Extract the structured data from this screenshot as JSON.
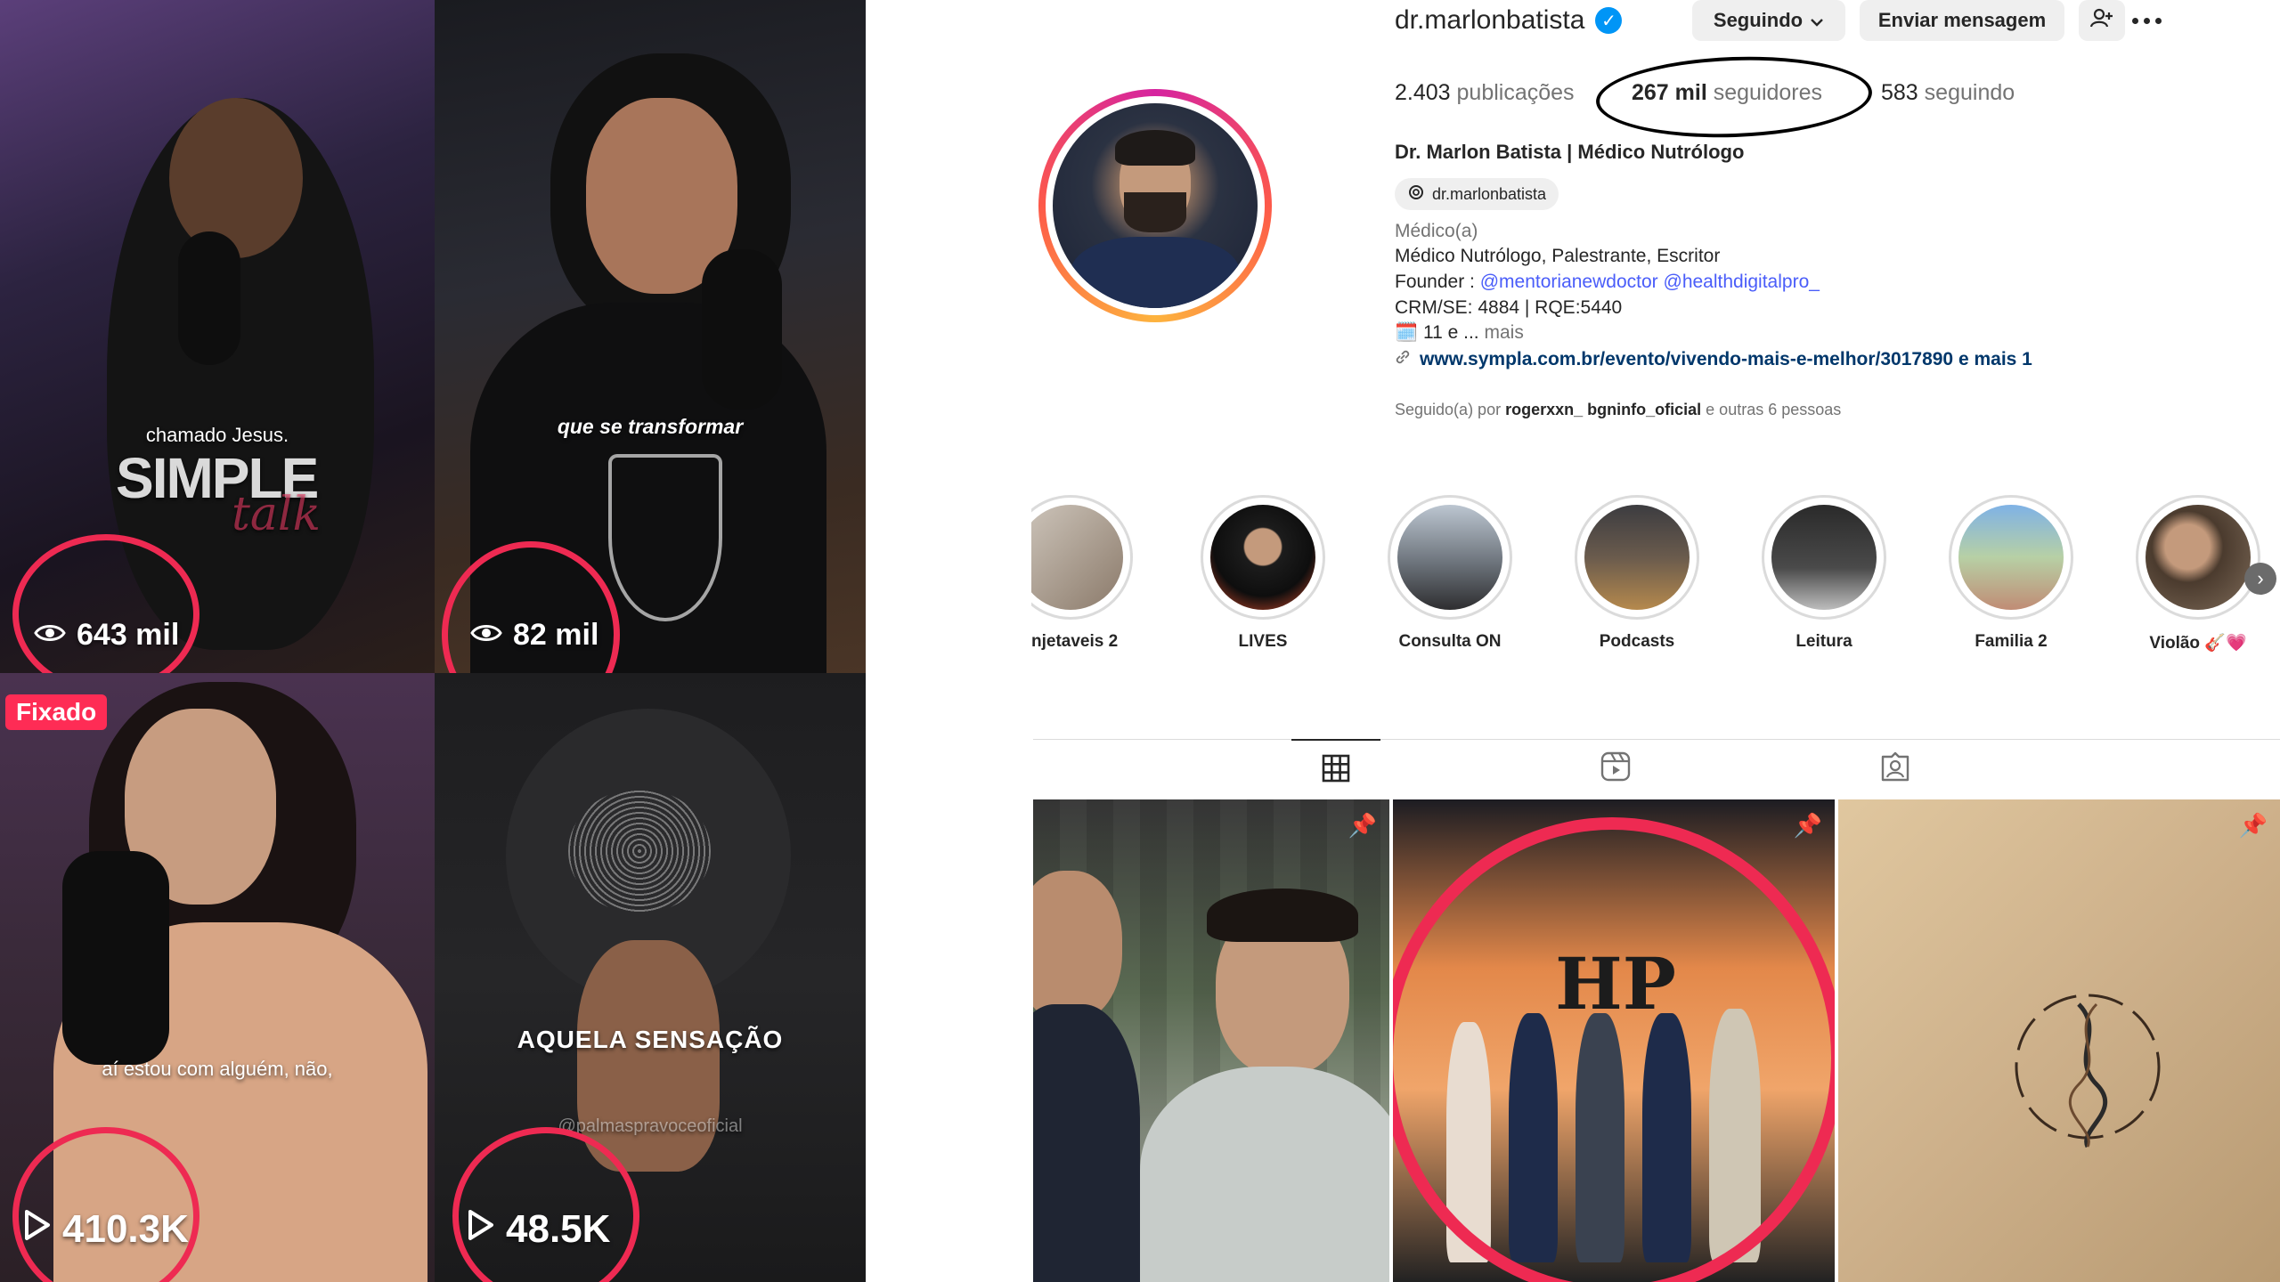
{
  "collage": {
    "tile1": {
      "caption": "chamado Jesus.",
      "logo": "SIMPLE",
      "logo_sub": "talk",
      "views": "643 mil"
    },
    "tile2": {
      "caption": "que se transformar",
      "views": "82 mil"
    },
    "tile3": {
      "badge": "Fixado",
      "caption": "aí estou com alguém, não,",
      "views": "410.3K"
    },
    "tile4": {
      "caption": "AQUELA SENSAÇÃO",
      "handle": "@palmaspravoceoficial",
      "views": "48.5K"
    },
    "ring_color": "#ee2a52"
  },
  "profile": {
    "username": "dr.marlonbatista",
    "follow_button": "Seguindo",
    "message_button": "Enviar mensagem",
    "stats": {
      "posts_value": "2.403",
      "posts_label": "publicações",
      "followers_value": "267 mil",
      "followers_label": "seguidores",
      "following_value": "583",
      "following_label": "seguindo"
    },
    "full_name": "Dr. Marlon Batista | Médico Nutrólogo",
    "threads_handle": "dr.marlonbatista",
    "category": "Médico(a)",
    "bio_line1": "Médico Nutrólogo, Palestrante, Escritor",
    "bio_founder": "Founder :",
    "bio_mention1": "@mentorianewdoctor",
    "bio_mention2": "@healthdigitalpro_",
    "bio_line3": "CRM/SE: 4884 | RQE:5440",
    "bio_line4": "🗓️ 11 e ...",
    "bio_more": "mais",
    "link": "www.sympla.com.br/evento/vivendo-mais-e-melhor/3017890 e mais 1",
    "followed_prefix": "Seguido(a) por",
    "followed_user1": "rogerxxn_",
    "followed_user2": "bgninfo_oficial",
    "followed_suffix": "e outras 6 pessoas",
    "highlights": [
      "njetaveis 2",
      "LIVES",
      "Consulta ON",
      "Podcasts",
      "Leitura",
      "Familia 2",
      "Violão 🎸💗"
    ],
    "brand_colors": {
      "verified": "#0095f6",
      "link": "#00376b",
      "mention": "#4a5df9"
    }
  }
}
